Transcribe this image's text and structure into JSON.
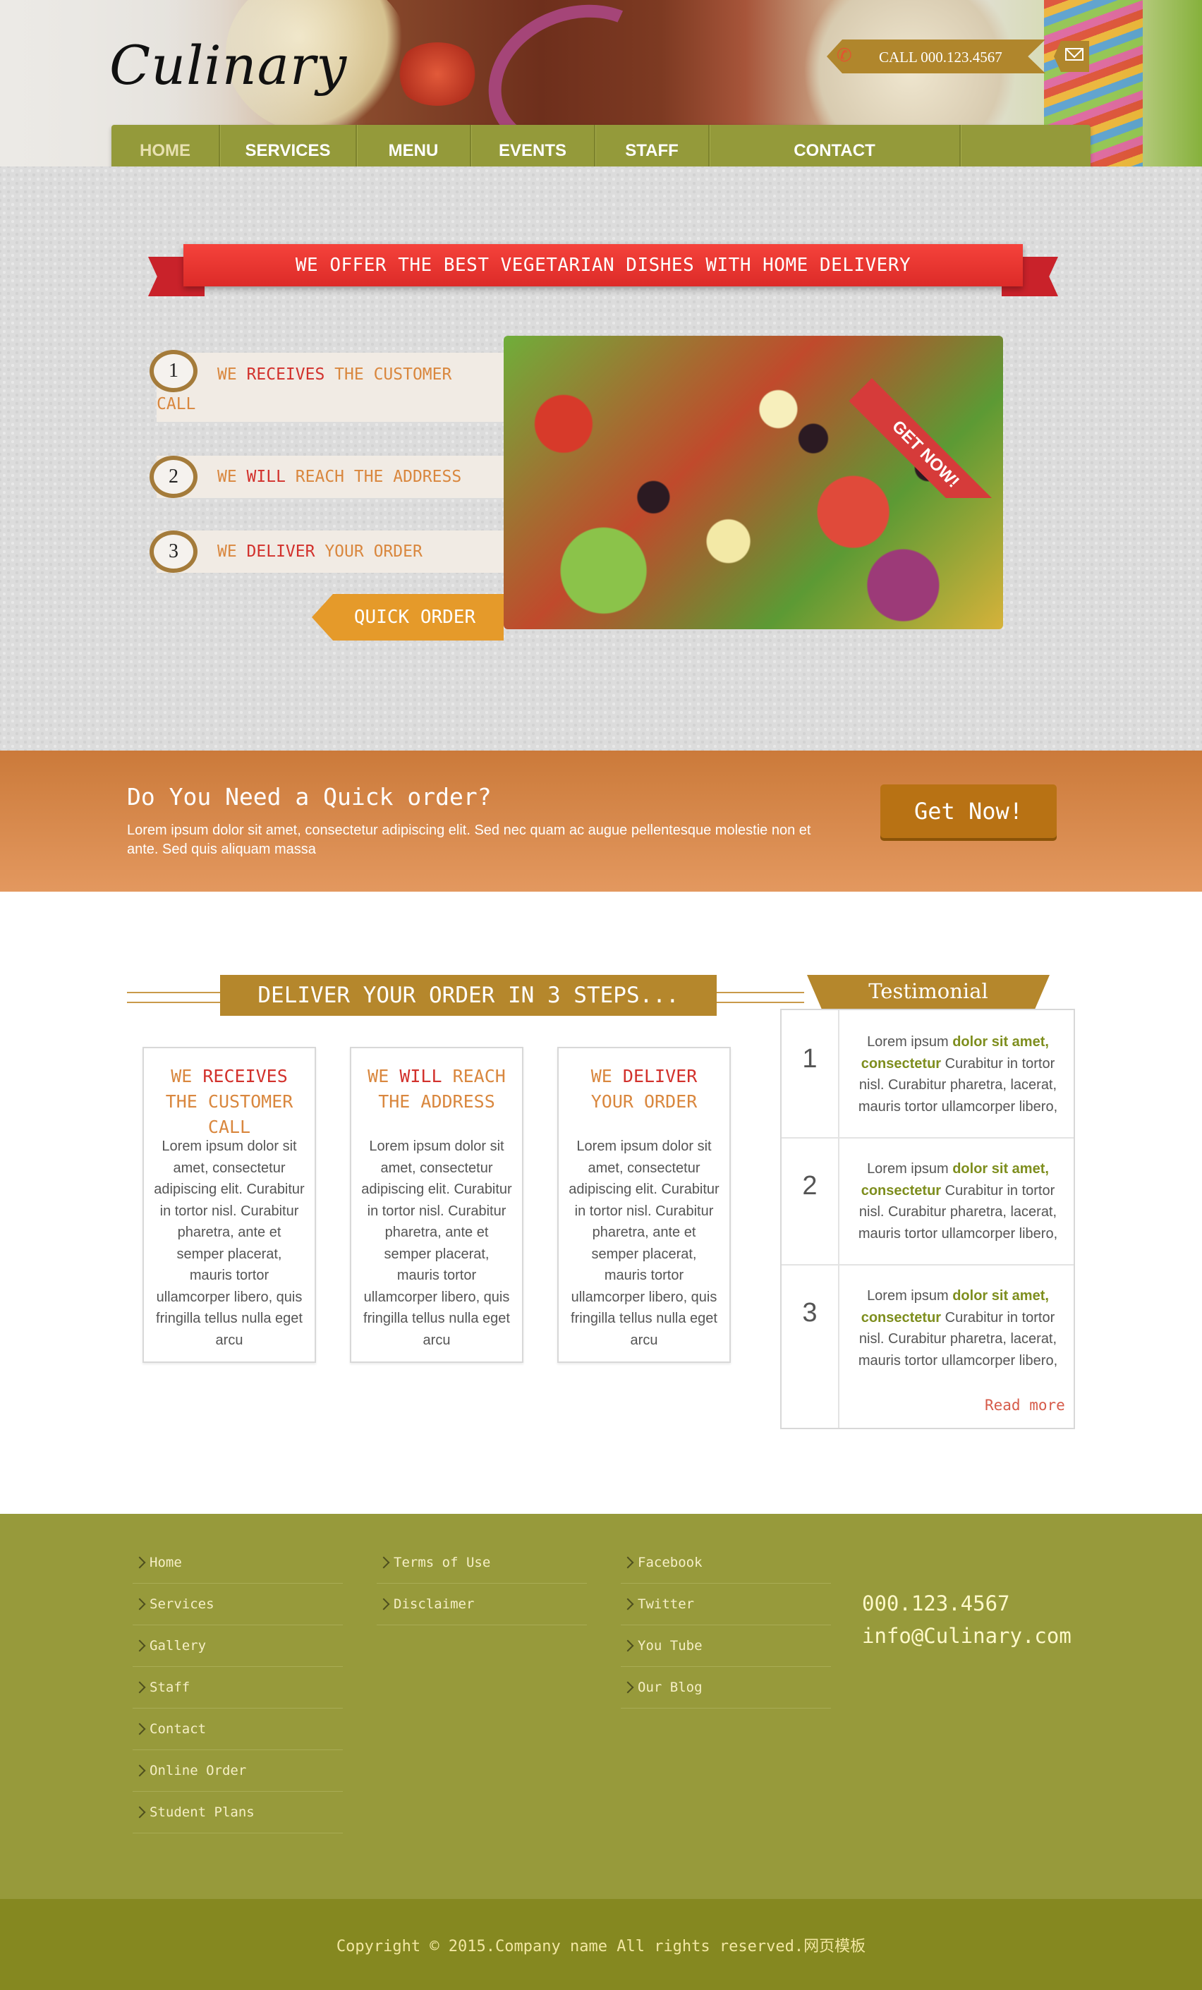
{
  "brand": {
    "logo": "Culinary"
  },
  "header": {
    "call_text": "CALL 000.123.4567"
  },
  "nav": [
    "HOME",
    "SERVICES",
    "MENU",
    "EVENTS",
    "STAFF",
    "CONTACT"
  ],
  "hero": {
    "ribbon": "WE OFFER THE BEST VEGETARIAN DISHES WITH HOME DELIVERY",
    "steps": [
      {
        "num": "1",
        "pre": "WE ",
        "hl": "RECEIVES",
        "post": " THE CUSTOMER CALL"
      },
      {
        "num": "2",
        "pre": "WE ",
        "hl": "WILL",
        "post": " REACH THE ADDRESS"
      },
      {
        "num": "3",
        "pre": "WE ",
        "hl": "DELIVER",
        "post": " YOUR ORDER"
      }
    ],
    "badge": "GET NOW!",
    "quick_order": "QUICK ORDER"
  },
  "banner": {
    "title": "Do You Need a Quick order?",
    "text": "Lorem ipsum dolor sit amet, consectetur adipiscing elit. Sed nec quam ac augue pellentesque molestie non et ante. Sed quis aliquam massa",
    "button": "Get Now!"
  },
  "steps_section": {
    "title": "DELIVER YOUR ORDER IN 3 STEPS...",
    "cards": [
      {
        "pre": "WE ",
        "hl": "RECEIVES",
        "post": " THE CUSTOMER CALL",
        "body": "Lorem ipsum dolor sit amet, consectetur adipiscing elit. Curabitur in tortor nisl. Curabitur pharetra, ante et semper placerat, mauris tortor ullamcorper libero, quis fringilla tellus nulla eget arcu"
      },
      {
        "pre": "WE ",
        "hl": "WILL",
        "post": " REACH THE ADDRESS",
        "body": "Lorem ipsum dolor sit amet, consectetur adipiscing elit. Curabitur in tortor nisl. Curabitur pharetra, ante et semper placerat, mauris tortor ullamcorper libero, quis fringilla tellus nulla eget arcu"
      },
      {
        "pre": "WE ",
        "hl": "DELIVER",
        "post": " YOUR ORDER",
        "body": "Lorem ipsum dolor sit amet, consectetur adipiscing elit. Curabitur in tortor nisl. Curabitur pharetra, ante et semper placerat, mauris tortor ullamcorper libero, quis fringilla tellus nulla eget arcu"
      }
    ]
  },
  "testimonial": {
    "title": "Testimonial",
    "items": [
      {
        "num": "1",
        "pre": "Lorem ipsum ",
        "bold": "dolor sit amet, consectetur",
        "post": " Curabitur in tortor nisl. Curabitur pharetra, lacerat, mauris tortor ullamcorper libero,"
      },
      {
        "num": "2",
        "pre": "Lorem ipsum ",
        "bold": "dolor sit amet, consectetur",
        "post": " Curabitur in tortor nisl. Curabitur pharetra, lacerat, mauris tortor ullamcorper libero,"
      },
      {
        "num": "3",
        "pre": "Lorem ipsum ",
        "bold": "dolor sit amet, consectetur",
        "post": " Curabitur in tortor nisl. Curabitur pharetra, lacerat, mauris tortor ullamcorper libero,"
      }
    ],
    "read_more": "Read more"
  },
  "footer": {
    "col1": [
      "Home",
      "Services",
      "Gallery",
      "Staff",
      "Contact",
      "Online Order",
      "Student Plans"
    ],
    "col2": [
      "Terms of Use",
      "Disclaimer"
    ],
    "col3": [
      "Facebook",
      "Twitter",
      "You Tube",
      "Our Blog"
    ],
    "phone": "000.123.4567",
    "email": "info@Culinary.com",
    "copyright": "Copyright © 2015.Company name All rights reserved.网页模板"
  },
  "colors": {
    "olive": "#979a3b",
    "gold": "#b5872c",
    "red": "#d2312c",
    "orange": "#e59a2a"
  }
}
